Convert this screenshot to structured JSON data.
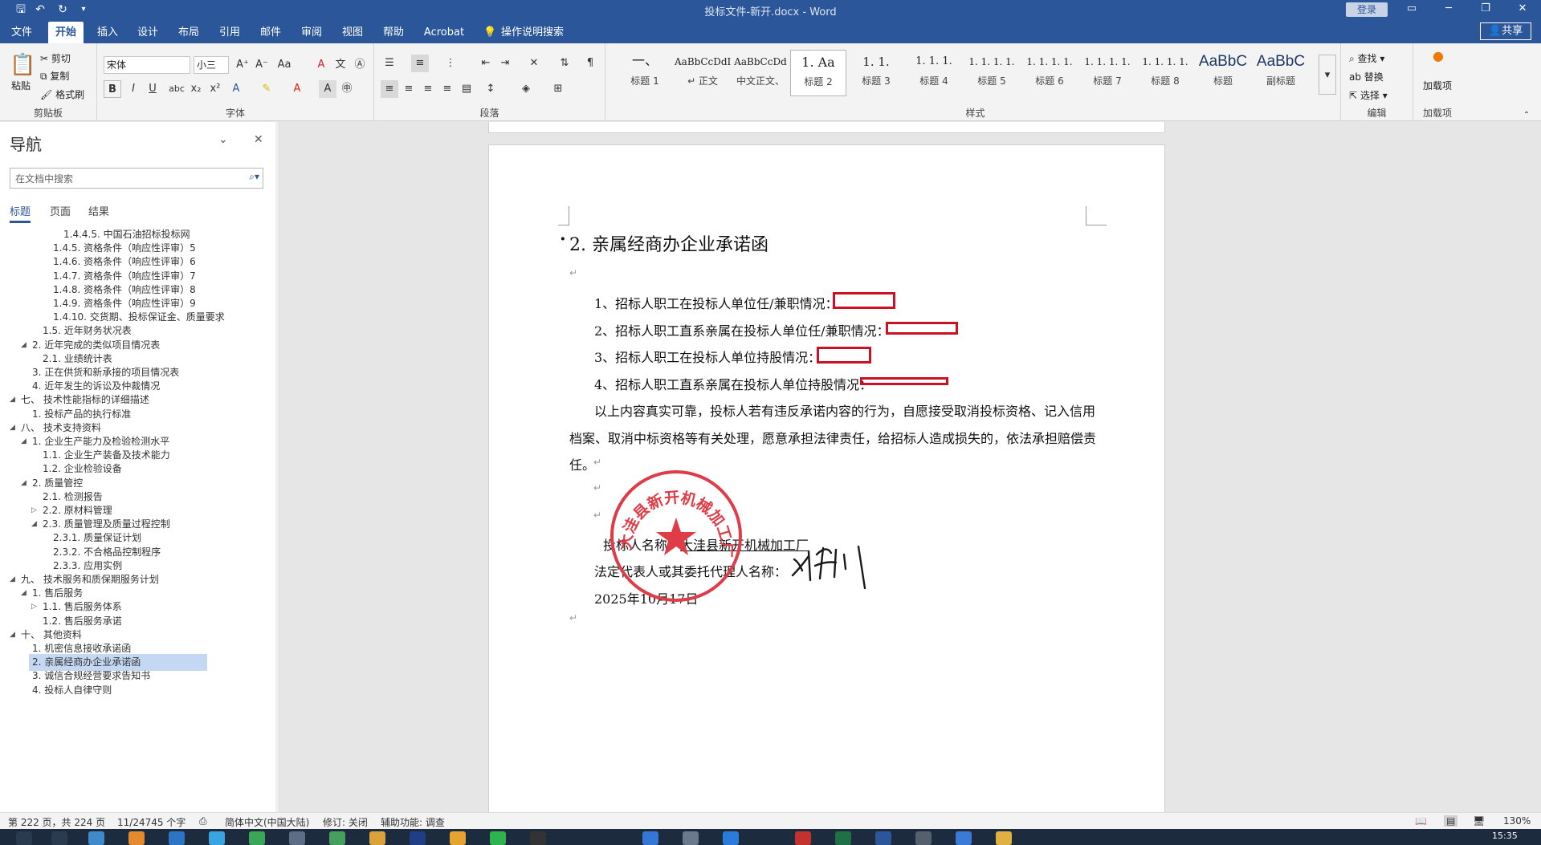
{
  "window": {
    "title": "投标文件-新开.docx - Word",
    "login": "登录"
  },
  "ribbon_tabs": [
    "文件",
    "开始",
    "插入",
    "设计",
    "布局",
    "引用",
    "邮件",
    "审阅",
    "视图",
    "帮助",
    "Acrobat"
  ],
  "tell_me": "操作说明搜索",
  "share": "共享",
  "clipboard": {
    "paste": "粘贴",
    "cut": "剪切",
    "copy": "复制",
    "format_painter": "格式刷",
    "label": "剪贴板"
  },
  "font": {
    "name": "宋体",
    "size": "小三",
    "label": "字体"
  },
  "paragraph": {
    "label": "段落"
  },
  "styles": {
    "label": "样式",
    "items": [
      {
        "preview": "一、",
        "name": "标题 1"
      },
      {
        "preview": "AaBbCcDdI",
        "name": "↵ 正文"
      },
      {
        "preview": "AaBbCcDd",
        "name": "中文正文、"
      },
      {
        "preview": "1.  Aa",
        "name": "标题 2"
      },
      {
        "preview": "1. 1.",
        "name": "标题 3"
      },
      {
        "preview": "1. 1. 1.",
        "name": "标题 4"
      },
      {
        "preview": "1. 1. 1. 1.",
        "name": "标题 5"
      },
      {
        "preview": "1. 1. 1. 1.",
        "name": "标题 6"
      },
      {
        "preview": "1. 1. 1. 1.",
        "name": "标题 7"
      },
      {
        "preview": "1. 1. 1. 1.",
        "name": "标题 8"
      },
      {
        "preview": "AaBbC",
        "name": "标题"
      },
      {
        "preview": "AaBbC",
        "name": "副标题"
      }
    ]
  },
  "editing": {
    "find": "查找",
    "replace": "替换",
    "select": "选择",
    "label": "编辑"
  },
  "addins": {
    "btn": "加载项",
    "label": "加载项"
  },
  "nav": {
    "title": "导航",
    "search_placeholder": "在文档中搜索",
    "tabs": [
      "标题",
      "页面",
      "结果"
    ],
    "items": [
      {
        "text": "1.4.4.5. 中国石油招标投标网"
      },
      {
        "text": "1.4.5. 资格条件（响应性评审）5"
      },
      {
        "text": "1.4.6. 资格条件（响应性评审）6"
      },
      {
        "text": "1.4.7. 资格条件（响应性评审）7"
      },
      {
        "text": "1.4.8. 资格条件（响应性评审）8"
      },
      {
        "text": "1.4.9. 资格条件（响应性评审）9"
      },
      {
        "text": "1.4.10. 交货期、投标保证金、质量要求"
      },
      {
        "text": "1.5. 近年财务状况表"
      },
      {
        "text": "2. 近年完成的类似项目情况表"
      },
      {
        "text": "2.1. 业绩统计表"
      },
      {
        "text": "3. 正在供货和新承接的项目情况表"
      },
      {
        "text": "4. 近年发生的诉讼及仲裁情况"
      },
      {
        "text": "七、 技术性能指标的详细描述"
      },
      {
        "text": "1. 投标产品的执行标准"
      },
      {
        "text": "八、 技术支持资料"
      },
      {
        "text": "1. 企业生产能力及检验检测水平"
      },
      {
        "text": "1.1. 企业生产装备及技术能力"
      },
      {
        "text": "1.2. 企业检验设备"
      },
      {
        "text": "2. 质量管控"
      },
      {
        "text": "2.1. 检测报告"
      },
      {
        "text": "2.2. 原材料管理"
      },
      {
        "text": "2.3. 质量管理及质量过程控制"
      },
      {
        "text": "2.3.1. 质量保证计划"
      },
      {
        "text": "2.3.2. 不合格品控制程序"
      },
      {
        "text": "2.3.3. 应用实例"
      },
      {
        "text": "九、 技术服务和质保期服务计划"
      },
      {
        "text": "1. 售后服务"
      },
      {
        "text": "1.1. 售后服务体系"
      },
      {
        "text": "1.2. 售后服务承诺"
      },
      {
        "text": "十、 其他资料"
      },
      {
        "text": "1. 机密信息接收承诺函"
      },
      {
        "text": "2. 亲属经商办企业承诺函"
      },
      {
        "text": "3. 诚信合规经营要求告知书"
      },
      {
        "text": "4. 投标人自律守则"
      }
    ]
  },
  "document": {
    "heading": "2. 亲属经商办企业承诺函",
    "items": [
      "1、招标人职工在投标人单位任/兼职情况：",
      "2、招标人职工直系亲属在投标人单位任/兼职情况：",
      "3、招标人职工在投标人单位持股情况：",
      "4、招标人职工直系亲属在投标人单位持股情况："
    ],
    "para_line1": "以上内容真实可靠，投标人若有违反承诺内容的行为，自愿接受取消投标资格、记入信用",
    "para_line2": "档案、取消中标资格等有关处理，愿意承担法律责任，给招标人造成损失的，依法承担赔偿责",
    "para_line3": "任。",
    "bidder_label": "投标人名称：",
    "bidder_name": "大洼县新开机械加工厂",
    "rep_label": "法定代表人或其委托代理人名称：",
    "date": "2025年10月17日",
    "seal_text": "大洼县新开机械加工厂",
    "signature": "刘利",
    "seal_color": "#e03c47"
  },
  "status": {
    "page": "第 222 页，共 224 页",
    "words": "11/24745 个字",
    "lang": "简体中文(中国大陆)",
    "track": "修订: 关闭",
    "access": "辅助功能: 调查",
    "zoom": "130%"
  },
  "taskbar": {
    "time": "15:35"
  }
}
